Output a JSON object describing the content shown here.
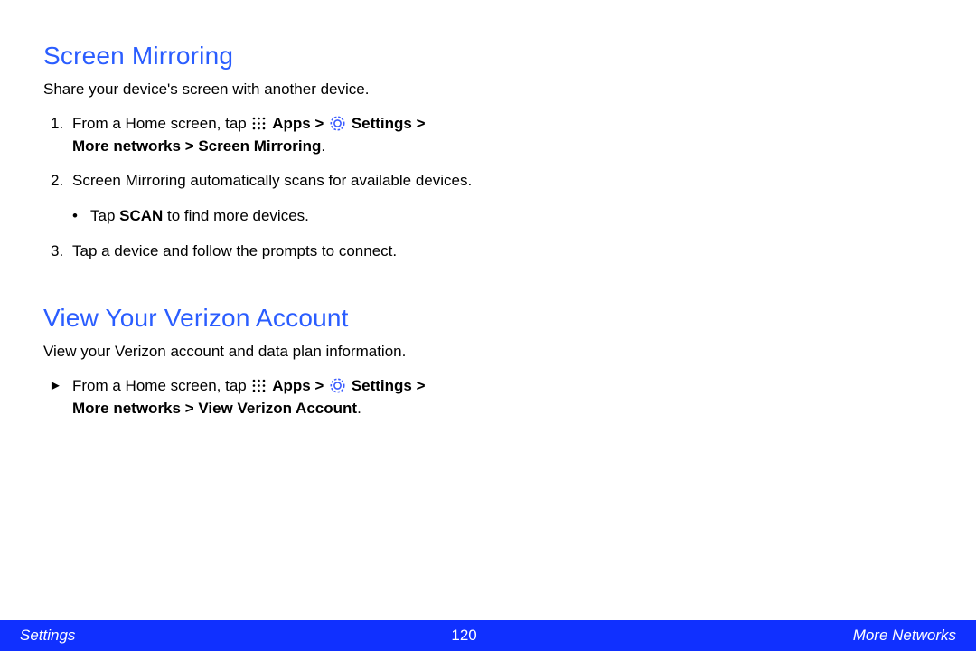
{
  "section1": {
    "title": "Screen Mirroring",
    "intro": "Share your device's screen with another device.",
    "step1_pre": "From a Home screen, tap ",
    "apps_label": "Apps > ",
    "settings_label": "Settings > ",
    "step1_line2": "More networks > Screen Mirroring",
    "step1_period": ".",
    "step2": "Screen Mirroring automatically scans for available devices.",
    "step2_bullet_pre": "Tap ",
    "step2_bullet_bold": "SCAN",
    "step2_bullet_post": " to find more devices.",
    "step3": "Tap a device and follow the prompts to connect."
  },
  "section2": {
    "title": "View Your Verizon Account",
    "intro": "View your Verizon account and data plan information.",
    "step1_pre": "From a Home screen, tap ",
    "apps_label": "Apps > ",
    "settings_label": "Settings > ",
    "step1_line2": "More networks > View Verizon Account",
    "step1_period": "."
  },
  "footer": {
    "left": "Settings",
    "center": "120",
    "right": "More Networks"
  },
  "nums": {
    "n1": "1.",
    "n2": "2.",
    "n3": "3.",
    "arrow": "►"
  }
}
